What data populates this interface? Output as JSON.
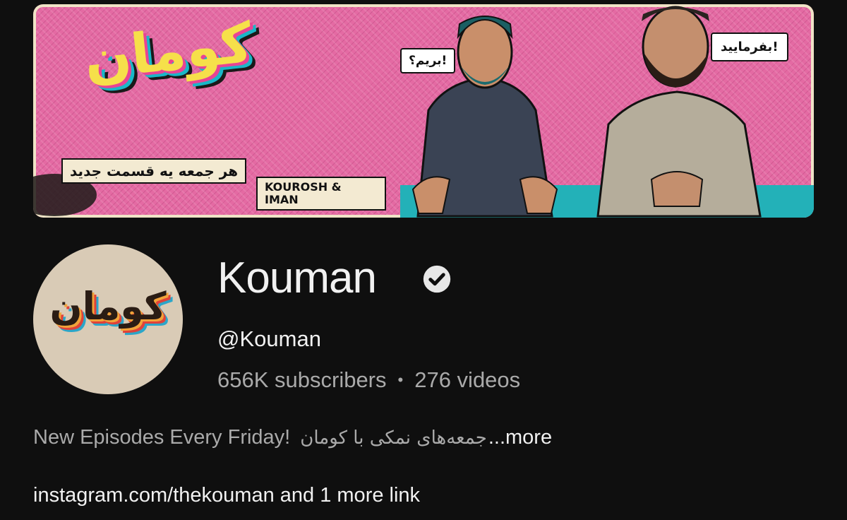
{
  "banner": {
    "logo_text": "کومان",
    "tagline": "هر جمعه یه قسمت جدید",
    "names": "KOUROSH & IMAN",
    "bubble_left": "بریم؟!",
    "bubble_right": "بفرمایید!"
  },
  "avatar": {
    "logo_text": "کومان"
  },
  "channel": {
    "name": "Kouman",
    "handle": "@Kouman",
    "subscribers": "656K subscribers",
    "separator": "•",
    "videos": "276 videos"
  },
  "description": {
    "text_en": "New Episodes Every Friday!",
    "text_fa": "جمعه‌های نمکی با کومان",
    "more": "...more"
  },
  "links": {
    "main": "instagram.com/thekouman",
    "extra": " and 1 more link"
  },
  "icons": {
    "verified": "verified-check-icon"
  },
  "colors": {
    "background": "#0f0f0f",
    "text_primary": "#f1f1f1",
    "text_secondary": "#aaaaaa"
  }
}
